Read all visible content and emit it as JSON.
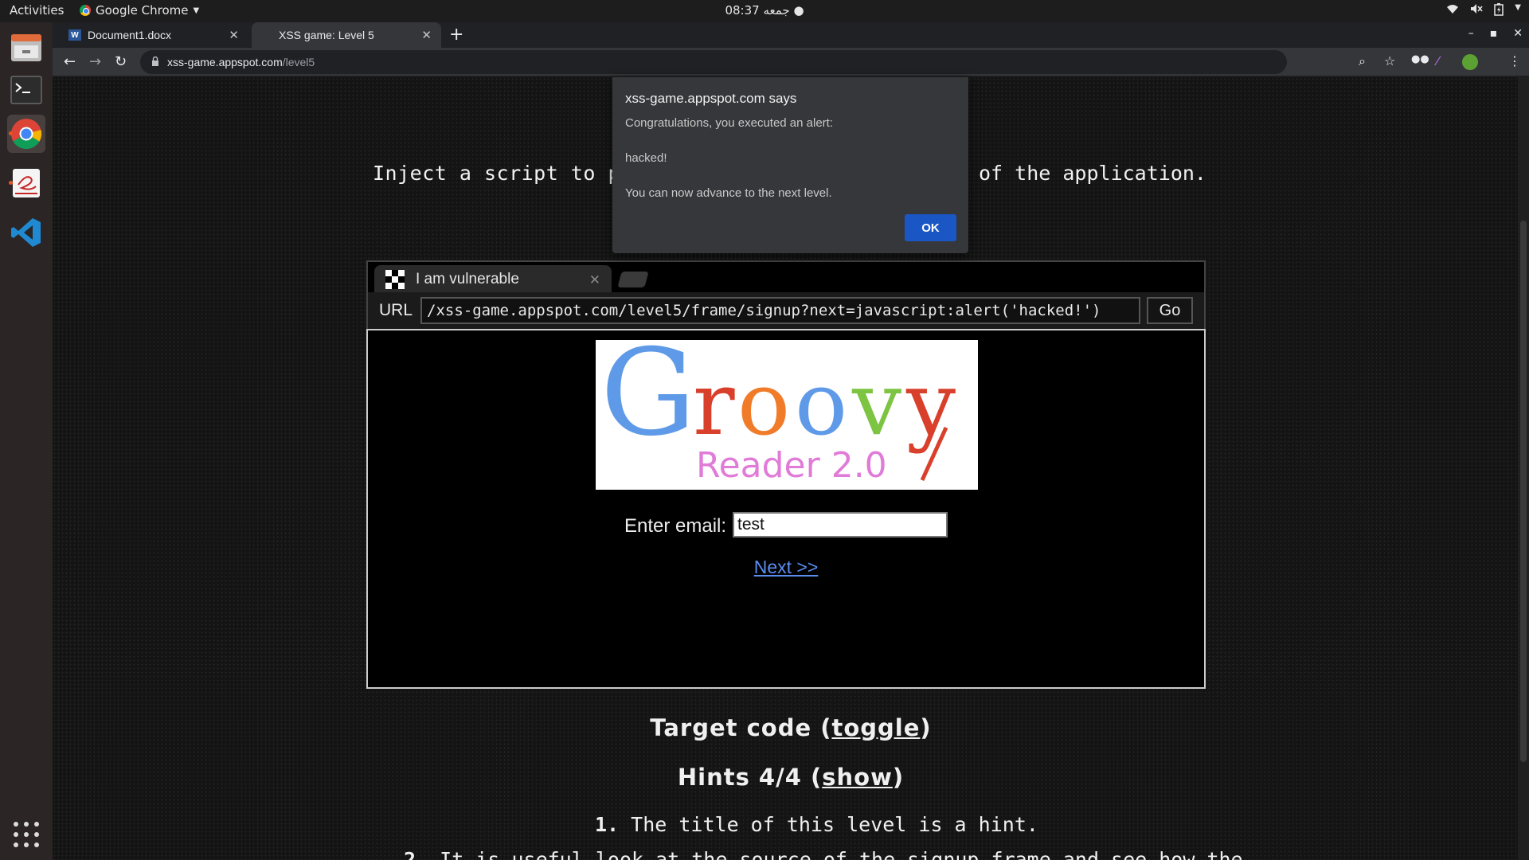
{
  "topbar": {
    "activities": "Activities",
    "app_name": "Google Chrome",
    "clock": "08:37 جمعه"
  },
  "dock": {
    "items": [
      "file-manager",
      "terminal",
      "chrome",
      "text-editor",
      "vscode"
    ],
    "apps_grid": "show-applications"
  },
  "browser": {
    "tabs": [
      {
        "title": "Document1.docx",
        "icon": "word-icon"
      },
      {
        "title": "XSS game: Level 5",
        "icon": "none"
      }
    ],
    "new_tab": "+",
    "omnibox": {
      "domain": "xss-game.appspot.com",
      "path": "/level5"
    }
  },
  "page": {
    "mission_left": "Inject a script to po",
    "mission_right": "of the application.",
    "frame": {
      "tab_title": "I am vulnerable",
      "url_label": "URL",
      "url_value": "/xss-game.appspot.com/level5/frame/signup?next=javascript:alert('hacked!')",
      "go_label": "Go",
      "logo_title": "Groovy",
      "logo_subtitle": "Reader 2.0",
      "email_label": "Enter email:",
      "email_value": "test",
      "next_label": "Next >>"
    },
    "target_code": {
      "prefix": "Target code (",
      "link": "toggle",
      "suffix": ")"
    },
    "hints": {
      "prefix": "Hints 4/4 (",
      "link": "show",
      "suffix": ")"
    },
    "hint_items": [
      {
        "num": "1.",
        "text": "The title of this level is a hint."
      },
      {
        "num": "2.",
        "text": "It is useful look at the source of the signup frame and see how the"
      }
    ]
  },
  "alert": {
    "title": "xss-game.appspot.com says",
    "line1": "Congratulations, you executed an alert:",
    "line2": "hacked!",
    "line3": "You can now advance to the next level.",
    "ok_label": "OK"
  },
  "colors": {
    "alert_ok": "#1a56c4",
    "link": "#5a8dee",
    "accent_orange": "#e95420"
  }
}
